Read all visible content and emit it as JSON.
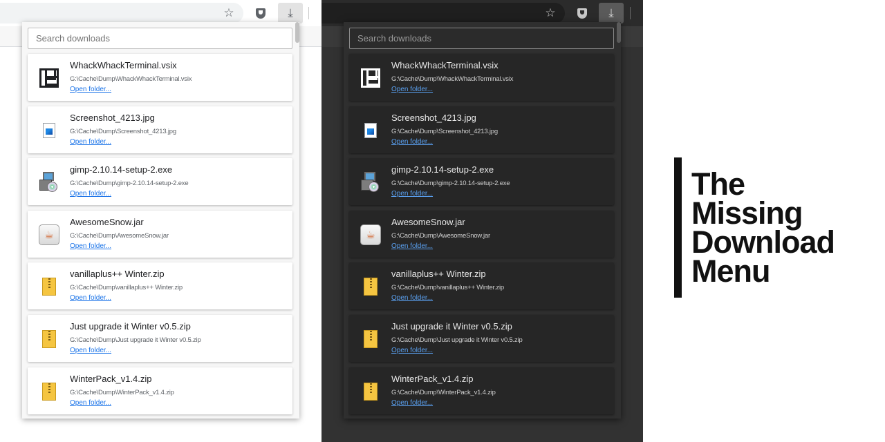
{
  "search": {
    "placeholder": "Search downloads"
  },
  "downloads": [
    {
      "name": "WhackWhackTerminal.vsix",
      "path": "G:\\Cache\\Dump\\WhackWhackTerminal.vsix",
      "link": "Open folder...",
      "icon": "vsix-file-icon"
    },
    {
      "name": "Screenshot_4213.jpg",
      "path": "G:\\Cache\\Dump\\Screenshot_4213.jpg",
      "link": "Open folder...",
      "icon": "image-file-icon"
    },
    {
      "name": "gimp-2.10.14-setup-2.exe",
      "path": "G:\\Cache\\Dump\\gimp-2.10.14-setup-2.exe",
      "link": "Open folder...",
      "icon": "installer-file-icon"
    },
    {
      "name": "AwesomeSnow.jar",
      "path": "G:\\Cache\\Dump\\AwesomeSnow.jar",
      "link": "Open folder...",
      "icon": "java-file-icon"
    },
    {
      "name": "vanillaplus++ Winter.zip",
      "path": "G:\\Cache\\Dump\\vanillaplus++ Winter.zip",
      "link": "Open folder...",
      "icon": "zip-file-icon"
    },
    {
      "name": "Just upgrade it Winter v0.5.zip",
      "path": "G:\\Cache\\Dump\\Just upgrade it Winter v0.5.zip",
      "link": "Open folder...",
      "icon": "zip-file-icon"
    },
    {
      "name": "WinterPack_v1.4.zip",
      "path": "G:\\Cache\\Dump\\WinterPack_v1.4.zip",
      "link": "Open folder...",
      "icon": "zip-file-icon"
    }
  ],
  "title": {
    "line1": "The",
    "line2": "Missing",
    "line3": "Download",
    "line4": "Menu"
  },
  "colors": {
    "light_bg": "#ffffff",
    "dark_bg": "#323232",
    "link_light": "#1a73e8",
    "link_dark": "#5aa0f0",
    "title": "#111111"
  },
  "toolbar_icons": [
    "star-icon",
    "shield-icon",
    "download-icon"
  ]
}
